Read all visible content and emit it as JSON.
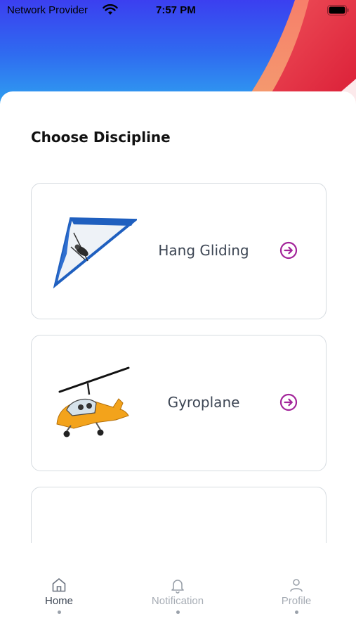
{
  "status_bar": {
    "carrier": "Network Provider",
    "time": "7:57 PM"
  },
  "main": {
    "title": "Choose Discipline",
    "disciplines": [
      {
        "label": "Hang Gliding",
        "icon": "hang-glider-image"
      },
      {
        "label": "Gyroplane",
        "icon": "gyroplane-image"
      },
      {
        "label": "",
        "icon": "aircraft-image"
      }
    ]
  },
  "bottom_nav": {
    "items": [
      {
        "label": "Home",
        "icon": "home-icon",
        "active": true
      },
      {
        "label": "Notification",
        "icon": "bell-icon",
        "active": false
      },
      {
        "label": "Profile",
        "icon": "user-icon",
        "active": false
      }
    ]
  },
  "colors": {
    "accent": "#a3249a",
    "header_blue": "#2f6bf0",
    "header_red": "#e02a3b"
  }
}
